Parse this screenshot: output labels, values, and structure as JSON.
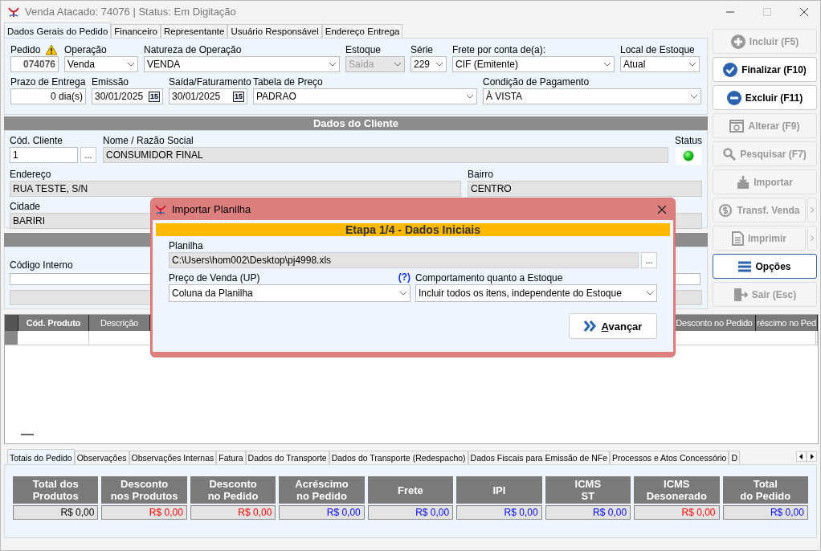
{
  "window": {
    "title": "Venda Atacado: 74076 | Status: Em Digitação"
  },
  "tabs": [
    {
      "label": "Dados Gerais do Pedido",
      "selected": true
    },
    {
      "label": "Financeiro",
      "selected": false
    },
    {
      "label": "Representante",
      "selected": false
    },
    {
      "label": "Usuário Responsável",
      "selected": false
    },
    {
      "label": "Endereço Entrega",
      "selected": false
    }
  ],
  "order_fields": [
    [
      {
        "label": "Pedido",
        "value": "074076",
        "kind": "code",
        "disabled": false
      },
      {
        "label": "Operação",
        "value": "Venda",
        "kind": "select",
        "disabled": false
      },
      {
        "label": "Natureza de Operação",
        "value": "VENDA",
        "kind": "select",
        "disabled": false
      },
      {
        "label": "Estoque",
        "value": "Saída",
        "kind": "select",
        "disabled": true
      },
      {
        "label": "Série",
        "value": "229",
        "kind": "select",
        "disabled": false
      },
      {
        "label": "Frete por conta de(a):",
        "value": "CIF (Emitente)",
        "kind": "select",
        "disabled": false
      },
      {
        "label": "Local de Estoque",
        "value": "Atual",
        "kind": "select",
        "disabled": false
      }
    ],
    [
      {
        "label": "Prazo de Entrega",
        "value": "0 dia(s)",
        "kind": "number",
        "disabled": false
      },
      {
        "label": "Emissão",
        "value": "30/01/2025",
        "kind": "date",
        "disabled": false,
        "calendar": "15"
      },
      {
        "label": "Saída/Faturamento",
        "value": "30/01/2025",
        "kind": "date",
        "disabled": false,
        "calendar": "15"
      },
      {
        "label": "Tabela de Preço",
        "value": "PADRAO",
        "kind": "select",
        "disabled": false
      },
      {
        "label": "Condição de Pagamento",
        "value": "À VISTA",
        "kind": "select",
        "disabled": false
      }
    ]
  ],
  "client_section": {
    "title": "Dados do Cliente",
    "code_label": "Cód. Cliente",
    "code": "1",
    "lookup": "...",
    "name_label": "Nome / Razão Social",
    "name": "CONSUMIDOR FINAL",
    "status_label": "Status",
    "address_label": "Endereço",
    "address": "RUA TESTE, S/N",
    "district_label": "Bairro",
    "district": "CENTRO",
    "city_label": "Cidade",
    "city": "BARIRI"
  },
  "product_section": {
    "code_label": "Código Interno"
  },
  "grid": {
    "columns": [
      {
        "label": "Cód. Produto"
      },
      {
        "label": "Descrição"
      },
      {
        "label": "Desconto no Pedido"
      },
      {
        "label": "réscimo no Ped"
      }
    ]
  },
  "bottom_tabs": [
    {
      "label": "Totais do Pedido",
      "selected": true
    },
    {
      "label": "Observações",
      "selected": false
    },
    {
      "label": "Observações Internas",
      "selected": false
    },
    {
      "label": "Fatura",
      "selected": false
    },
    {
      "label": "Dados do Transporte",
      "selected": false
    },
    {
      "label": "Dados do Transporte (Redespacho)",
      "selected": false
    },
    {
      "label": "Dados Fiscais para Emissão de NFe",
      "selected": false
    },
    {
      "label": "Processos e Atos Concessório",
      "selected": false
    },
    {
      "label": "D",
      "selected": false
    }
  ],
  "totals": [
    {
      "label": "Total dos\nProdutos",
      "value": "R$ 0,00",
      "color": "#000000"
    },
    {
      "label": "Desconto\nnos Produtos",
      "value": "R$ 0,00",
      "color": "#ff0000"
    },
    {
      "label": "Desconto\nno Pedido",
      "value": "R$ 0,00",
      "color": "#ff0000"
    },
    {
      "label": "Acréscimo\nno Pedido",
      "value": "R$ 0,00",
      "color": "#0000ff"
    },
    {
      "label": "Frete",
      "value": "R$ 0,00",
      "color": "#0000ff"
    },
    {
      "label": "IPI",
      "value": "R$ 0,00",
      "color": "#0000ff"
    },
    {
      "label": "ICMS\nST",
      "value": "R$ 0,00",
      "color": "#0000ff"
    },
    {
      "label": "ICMS\nDesonerado",
      "value": "R$ 0,00",
      "color": "#ff0000"
    },
    {
      "label": "Total\ndo Pedido",
      "value": "R$ 0,00",
      "color": "#0000ff"
    }
  ],
  "actions": [
    {
      "label": "Incluir (F5)",
      "kind": "plus",
      "disabled": true,
      "focused": false,
      "has_menu": false
    },
    {
      "label": "Finalizar (F10)",
      "kind": "check",
      "disabled": false,
      "focused": false,
      "has_menu": false
    },
    {
      "label": "Excluir (F11)",
      "kind": "minus",
      "disabled": false,
      "focused": false,
      "has_menu": false
    },
    {
      "label": "Alterar (F9)",
      "kind": "edit",
      "disabled": true,
      "focused": false,
      "has_menu": false
    },
    {
      "label": "Pesquisar (F7)",
      "kind": "search",
      "disabled": true,
      "focused": false,
      "has_menu": false
    },
    {
      "label": "Importar",
      "kind": "import",
      "disabled": true,
      "focused": false,
      "has_menu": false
    },
    {
      "label": "Transf. Venda",
      "kind": "transfer",
      "disabled": true,
      "focused": false,
      "has_menu": true
    },
    {
      "label": "Imprimir",
      "kind": "print",
      "disabled": true,
      "focused": false,
      "has_menu": true
    },
    {
      "label": "Opções",
      "kind": "menu",
      "disabled": false,
      "focused": true,
      "has_menu": false
    },
    {
      "label": "Sair (Esc)",
      "kind": "exit",
      "disabled": true,
      "focused": false,
      "has_menu": false
    }
  ],
  "dialog": {
    "title": "Importar Planilha",
    "step": "Etapa 1/4 - Dados Iniciais",
    "file_label": "Planilha",
    "file": "C:\\Users\\hom002\\Desktop\\pj4998.xls",
    "browse": "...",
    "price_label": "Preço de Venda (UP)",
    "help": "(?)",
    "price": "Coluna da Planilha",
    "stock_label": "Comportamento quanto a Estoque",
    "stock": "Incluir todos os itens, independente do Estoque",
    "next": "Avançar"
  }
}
